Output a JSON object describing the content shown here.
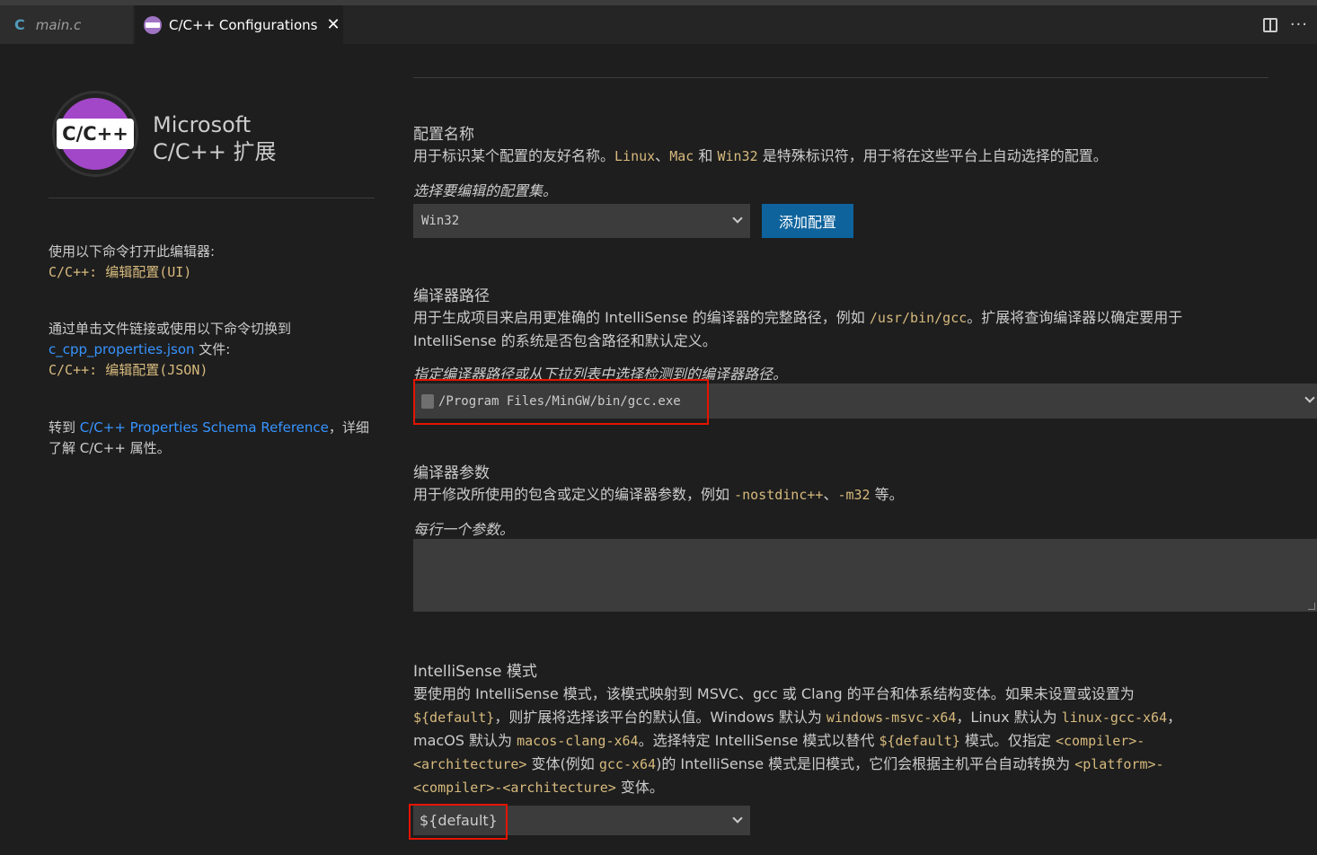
{
  "tabs": [
    {
      "icon": "c-file-icon",
      "icon_text": "C",
      "label": "main.c",
      "active": false
    },
    {
      "icon": "cpp-extension-icon",
      "label": "C/C++ Configurations",
      "active": true
    }
  ],
  "tab_close_symbol": "✕",
  "tab_more_symbol": "···",
  "sidebar": {
    "logo_text": "C/C++",
    "brand_line1": "Microsoft",
    "brand_line2": "C/C++ 扩展",
    "open_editor_text": "使用以下命令打开此编辑器:",
    "open_editor_command": "C/C++: 编辑配置(UI)",
    "switch_text": "通过单击文件链接或使用以下命令切换到",
    "switch_file_link": "c_cpp_properties.json",
    "switch_file_suffix": " 文件:",
    "switch_command": "C/C++: 编辑配置(JSON)",
    "goto_prefix": "转到 ",
    "goto_link": "C/C++ Properties Schema Reference",
    "goto_suffix": "，详细了解 C/C++ 属性。"
  },
  "config_name": {
    "heading": "配置名称",
    "desc_part1": "用于标识某个配置的友好名称。",
    "code1": "Linux",
    "sep1": "、",
    "code2": "Mac",
    "sep2": " 和 ",
    "code3": "Win32",
    "desc_part2": " 是特殊标识符，用于将在这些平台上自动选择的配置。",
    "hint": "选择要编辑的配置集。",
    "selected": "Win32",
    "add_button": "添加配置"
  },
  "compiler_path": {
    "heading": "编译器路径",
    "desc_part1": "用于生成项目来启用更准确的 IntelliSense 的编译器的完整路径，例如 ",
    "code1": "/usr/bin/gcc",
    "desc_part2": "。扩展将查询编译器以确定要用于 IntelliSense 的系统是否包含路径和默认定义。",
    "hint": "指定编译器路径或从下拉列表中选择检测到的编译器路径。",
    "value": "/Program Files/MinGW/bin/gcc.exe"
  },
  "compiler_args": {
    "heading": "编译器参数",
    "desc_part1": "用于修改所使用的包含或定义的编译器参数，例如 ",
    "code1": "-nostdinc++",
    "sep1": "、",
    "code2": "-m32",
    "desc_part2": " 等。",
    "hint": "每行一个参数。",
    "value": ""
  },
  "intellisense_mode": {
    "heading": "IntelliSense 模式",
    "l1": "要使用的 IntelliSense 模式，该模式映射到 MSVC、gcc 或 Clang 的平台和体系结构变体。如果未设置或设置为",
    "c1": "${default}",
    "t2": "，则扩展将选择该平台的默认值。Windows 默认为 ",
    "c2": "windows-msvc-x64",
    "t3": "，Linux 默认为 ",
    "c3": "linux-gcc-x64",
    "t4": "，",
    "t5": "macOS 默认为 ",
    "c4": "macos-clang-x64",
    "t6": "。选择特定 IntelliSense 模式以替代 ",
    "c5": "${default}",
    "t7": " 模式。仅指定 ",
    "c6": "<compiler>-",
    "c7": "<architecture>",
    "t8": " 变体(例如 ",
    "c8": "gcc-x64",
    "t9": ")的 IntelliSense 模式是旧模式，它们会根据主机平台自动转换为 ",
    "c9": "<platform>-",
    "c10": "<compiler>-<architecture>",
    "t10": " 变体。",
    "selected": "${default}"
  },
  "colors": {
    "background": "#1e1e1e",
    "accent_button": "#0e639c",
    "link": "#3794ff",
    "code": "#d7ba7d",
    "highlight_box": "#e51400"
  }
}
